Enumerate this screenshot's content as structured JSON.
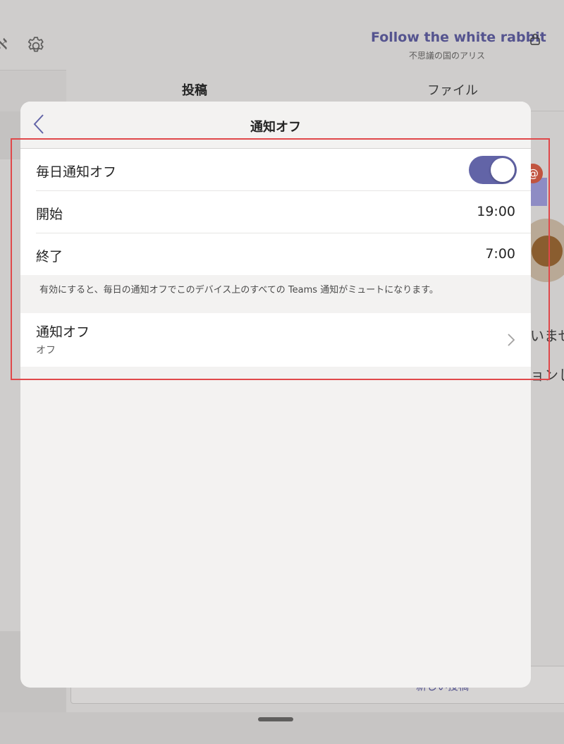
{
  "background": {
    "channel_title": "Follow the white rabbit",
    "channel_subtitle": "不思議の国のアリス",
    "tabs": [
      {
        "label": "投稿"
      },
      {
        "label": "ファイル"
      }
    ],
    "mention_badge": "@",
    "partial_text_1": "いませ",
    "partial_text_2": "ョンし",
    "compose_label": "新しい投稿",
    "icons": [
      "add-people-icon",
      "gear-icon",
      "lock-icon"
    ]
  },
  "sheet": {
    "title": "通知オフ",
    "back_icon": "chevron-left-icon",
    "daily_quiet": {
      "label": "毎日通知オフ",
      "enabled": true,
      "toggle_color": "#6264a7"
    },
    "start": {
      "label": "開始",
      "value": "19:00"
    },
    "end": {
      "label": "終了",
      "value": "7:00"
    },
    "info": "有効にすると、毎日の通知オフでこのデバイス上のすべての Teams 通知がミュートになります。",
    "quiet_days": {
      "label": "通知オフ",
      "sub_label": "オフ",
      "icon": "chevron-right-icon"
    }
  },
  "highlight_color": "#e0484a"
}
